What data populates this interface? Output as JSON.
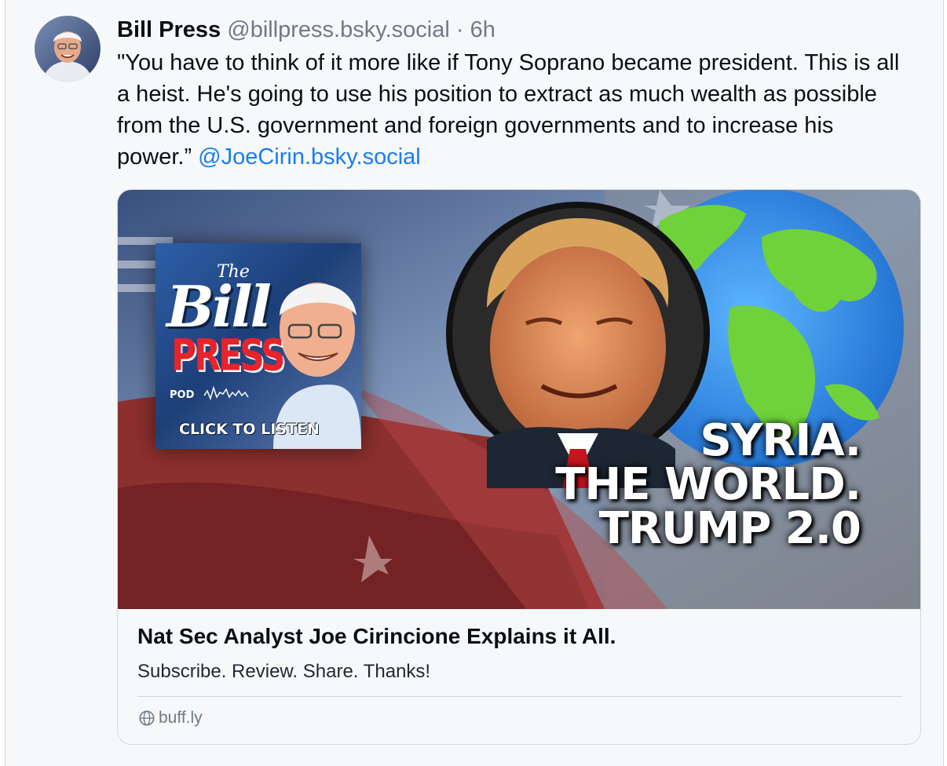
{
  "post": {
    "author": {
      "display_name": "Bill Press",
      "handle": "@billpress.bsky.social",
      "separator": "·",
      "time": "6h",
      "avatar_icon": "user-avatar"
    },
    "text": "\"You have to think of it more like if Tony Soprano became president. This is all a heist. He's going to use his position to extract as much wealth as possible from the U.S. government and foreign governments and to increase his power.” ",
    "mention": "@JoeCirin.bsky.social",
    "colors": {
      "link": "#1a7df0",
      "muted": "#6f7a86",
      "background": "#f7f8fa"
    }
  },
  "embed": {
    "thumbnail": {
      "podcast_tile": {
        "the": "The",
        "bill": "Bill",
        "press": "PRESS",
        "pod": "POD",
        "cta": "CLICK TO LISTEN"
      },
      "headline_lines": [
        "SYRIA.",
        "THE WORLD.",
        "TRUMP 2.0"
      ]
    },
    "title": "Nat Sec Analyst Joe Cirincione Explains it All.",
    "description": "Subscribe. Review. Share. Thanks!",
    "domain": "buff.ly",
    "domain_icon": "globe-icon"
  }
}
